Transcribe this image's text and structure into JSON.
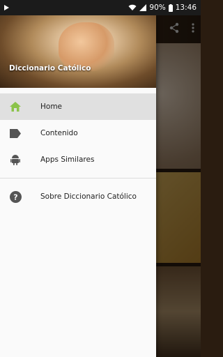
{
  "status_bar": {
    "battery": "90%",
    "time": "13:46"
  },
  "drawer": {
    "header_title": "Diccionario Católico",
    "items": [
      {
        "label": "Home",
        "icon": "home-icon",
        "active": true
      },
      {
        "label": "Contenido",
        "icon": "label-icon",
        "active": false
      },
      {
        "label": "Apps Similares",
        "icon": "android-icon",
        "active": false
      }
    ],
    "secondary_items": [
      {
        "label": "Sobre Diccionario Católico",
        "icon": "help-icon"
      }
    ]
  },
  "colors": {
    "accent_green": "#8bc34a",
    "icon_gray": "#555555",
    "active_bg": "#e0e0e0"
  }
}
